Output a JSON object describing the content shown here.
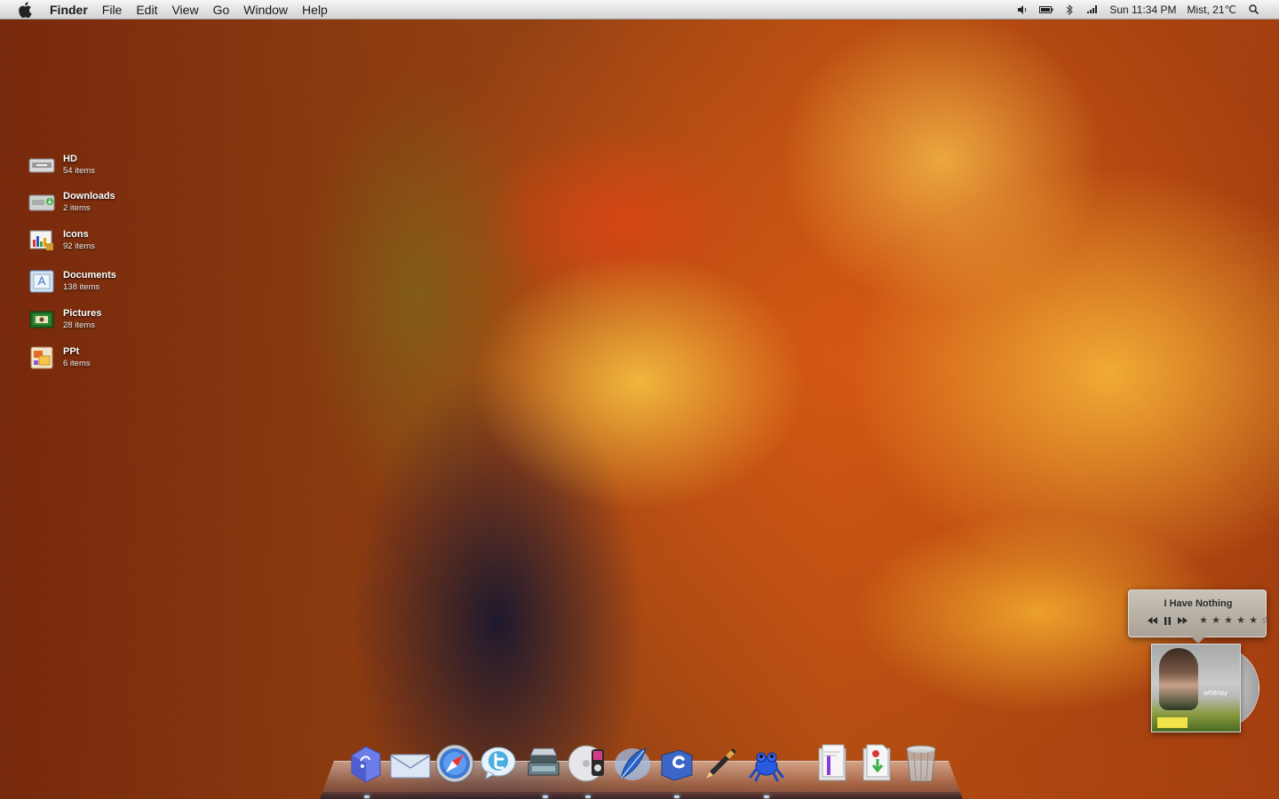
{
  "menubar": {
    "app_name": "Finder",
    "items": [
      "File",
      "Edit",
      "View",
      "Go",
      "Window",
      "Help"
    ],
    "status": {
      "clock": "Sun 11:34 PM",
      "weather": "Mist, 21℃"
    }
  },
  "desktop": {
    "items": [
      {
        "name": "HD",
        "count": "54 items",
        "icon": "hard-drive-icon"
      },
      {
        "name": "Downloads",
        "count": "2 items",
        "icon": "downloads-folder-icon"
      },
      {
        "name": "Icons",
        "count": "92 items",
        "icon": "icons-folder-icon"
      },
      {
        "name": "Documents",
        "count": "138 items",
        "icon": "documents-folder-icon"
      },
      {
        "name": "Pictures",
        "count": "28 items",
        "icon": "pictures-folder-icon"
      },
      {
        "name": "PPt",
        "count": "6 items",
        "icon": "ppt-folder-icon"
      }
    ]
  },
  "now_playing": {
    "title": "I Have Nothing",
    "rating": 5,
    "rating_max": 6,
    "album_text": "whitney"
  },
  "dock": {
    "apps": [
      "finder-icon",
      "mail-icon",
      "safari-icon",
      "twitter-icon",
      "scanner-icon",
      "itunes-icon",
      "feather-icon",
      "c-app-icon",
      "pen-icon",
      "frog-icon"
    ],
    "stacks": [
      "documents-stack-icon",
      "torrent-stack-icon",
      "trash-icon"
    ]
  },
  "colors": {
    "menubar": "#e6e6e6",
    "wallpaper_primary": "#b64e12",
    "wallpaper_highlight": "#ffbe3c"
  }
}
